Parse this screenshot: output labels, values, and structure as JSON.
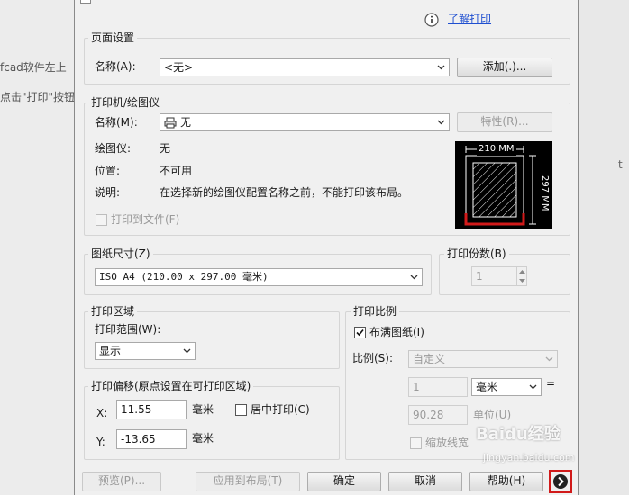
{
  "background": {
    "left_snippet_1": "fcad软件左上",
    "left_snippet_2": "点击\"打印\"按钮",
    "right_fragment": "t"
  },
  "header": {
    "info_icon": "info-icon",
    "learn_print_link": "了解打印"
  },
  "page_setup": {
    "title": "页面设置",
    "name_label": "名称(A):",
    "name_value": "<无>",
    "add_button": "添加(.)..."
  },
  "printer": {
    "title": "打印机/绘图仪",
    "name_label": "名称(M):",
    "name_value": "无",
    "properties_button": "特性(R)...",
    "plotter_label": "绘图仪:",
    "plotter_value": "无",
    "location_label": "位置:",
    "location_value": "不可用",
    "description_label": "说明:",
    "description_value": "在选择新的绘图仪配置名称之前，不能打印该布局。",
    "print_to_file": "打印到文件(F)",
    "preview_width": "210 MM",
    "preview_height": "297 MM"
  },
  "paper_size": {
    "title": "图纸尺寸(Z)",
    "value": "ISO A4 (210.00 x 297.00 毫米)"
  },
  "copies": {
    "title": "打印份数(B)",
    "value": "1"
  },
  "print_area": {
    "title": "打印区域",
    "range_label": "打印范围(W):",
    "range_value": "显示"
  },
  "print_offset": {
    "title": "打印偏移(原点设置在可打印区域)",
    "x_label": "X:",
    "x_value": "11.55",
    "x_unit": "毫米",
    "y_label": "Y:",
    "y_value": "-13.65",
    "y_unit": "毫米",
    "center_print": "居中打印(C)"
  },
  "print_scale": {
    "title": "打印比例",
    "fit_paper": "布满图纸(I)",
    "fit_paper_checked": true,
    "scale_label": "比例(S):",
    "scale_value": "自定义",
    "num_value": "1",
    "num_unit": "毫米",
    "equals": "=",
    "den_value": "90.28",
    "den_unit": "单位(U)",
    "scale_lineweights": "缩放线宽"
  },
  "footer": {
    "preview": "预览(P)...",
    "apply_layout": "应用到布局(T)",
    "ok": "确定",
    "cancel": "取消",
    "help": "帮助(H)"
  },
  "watermark": {
    "brand": "Baidu经验",
    "url": "jingyan.baidu.com"
  },
  "colors": {
    "link": "#1f4fd0",
    "highlight": "#d11a1a",
    "dialog_bg": "#f0f0f0"
  }
}
